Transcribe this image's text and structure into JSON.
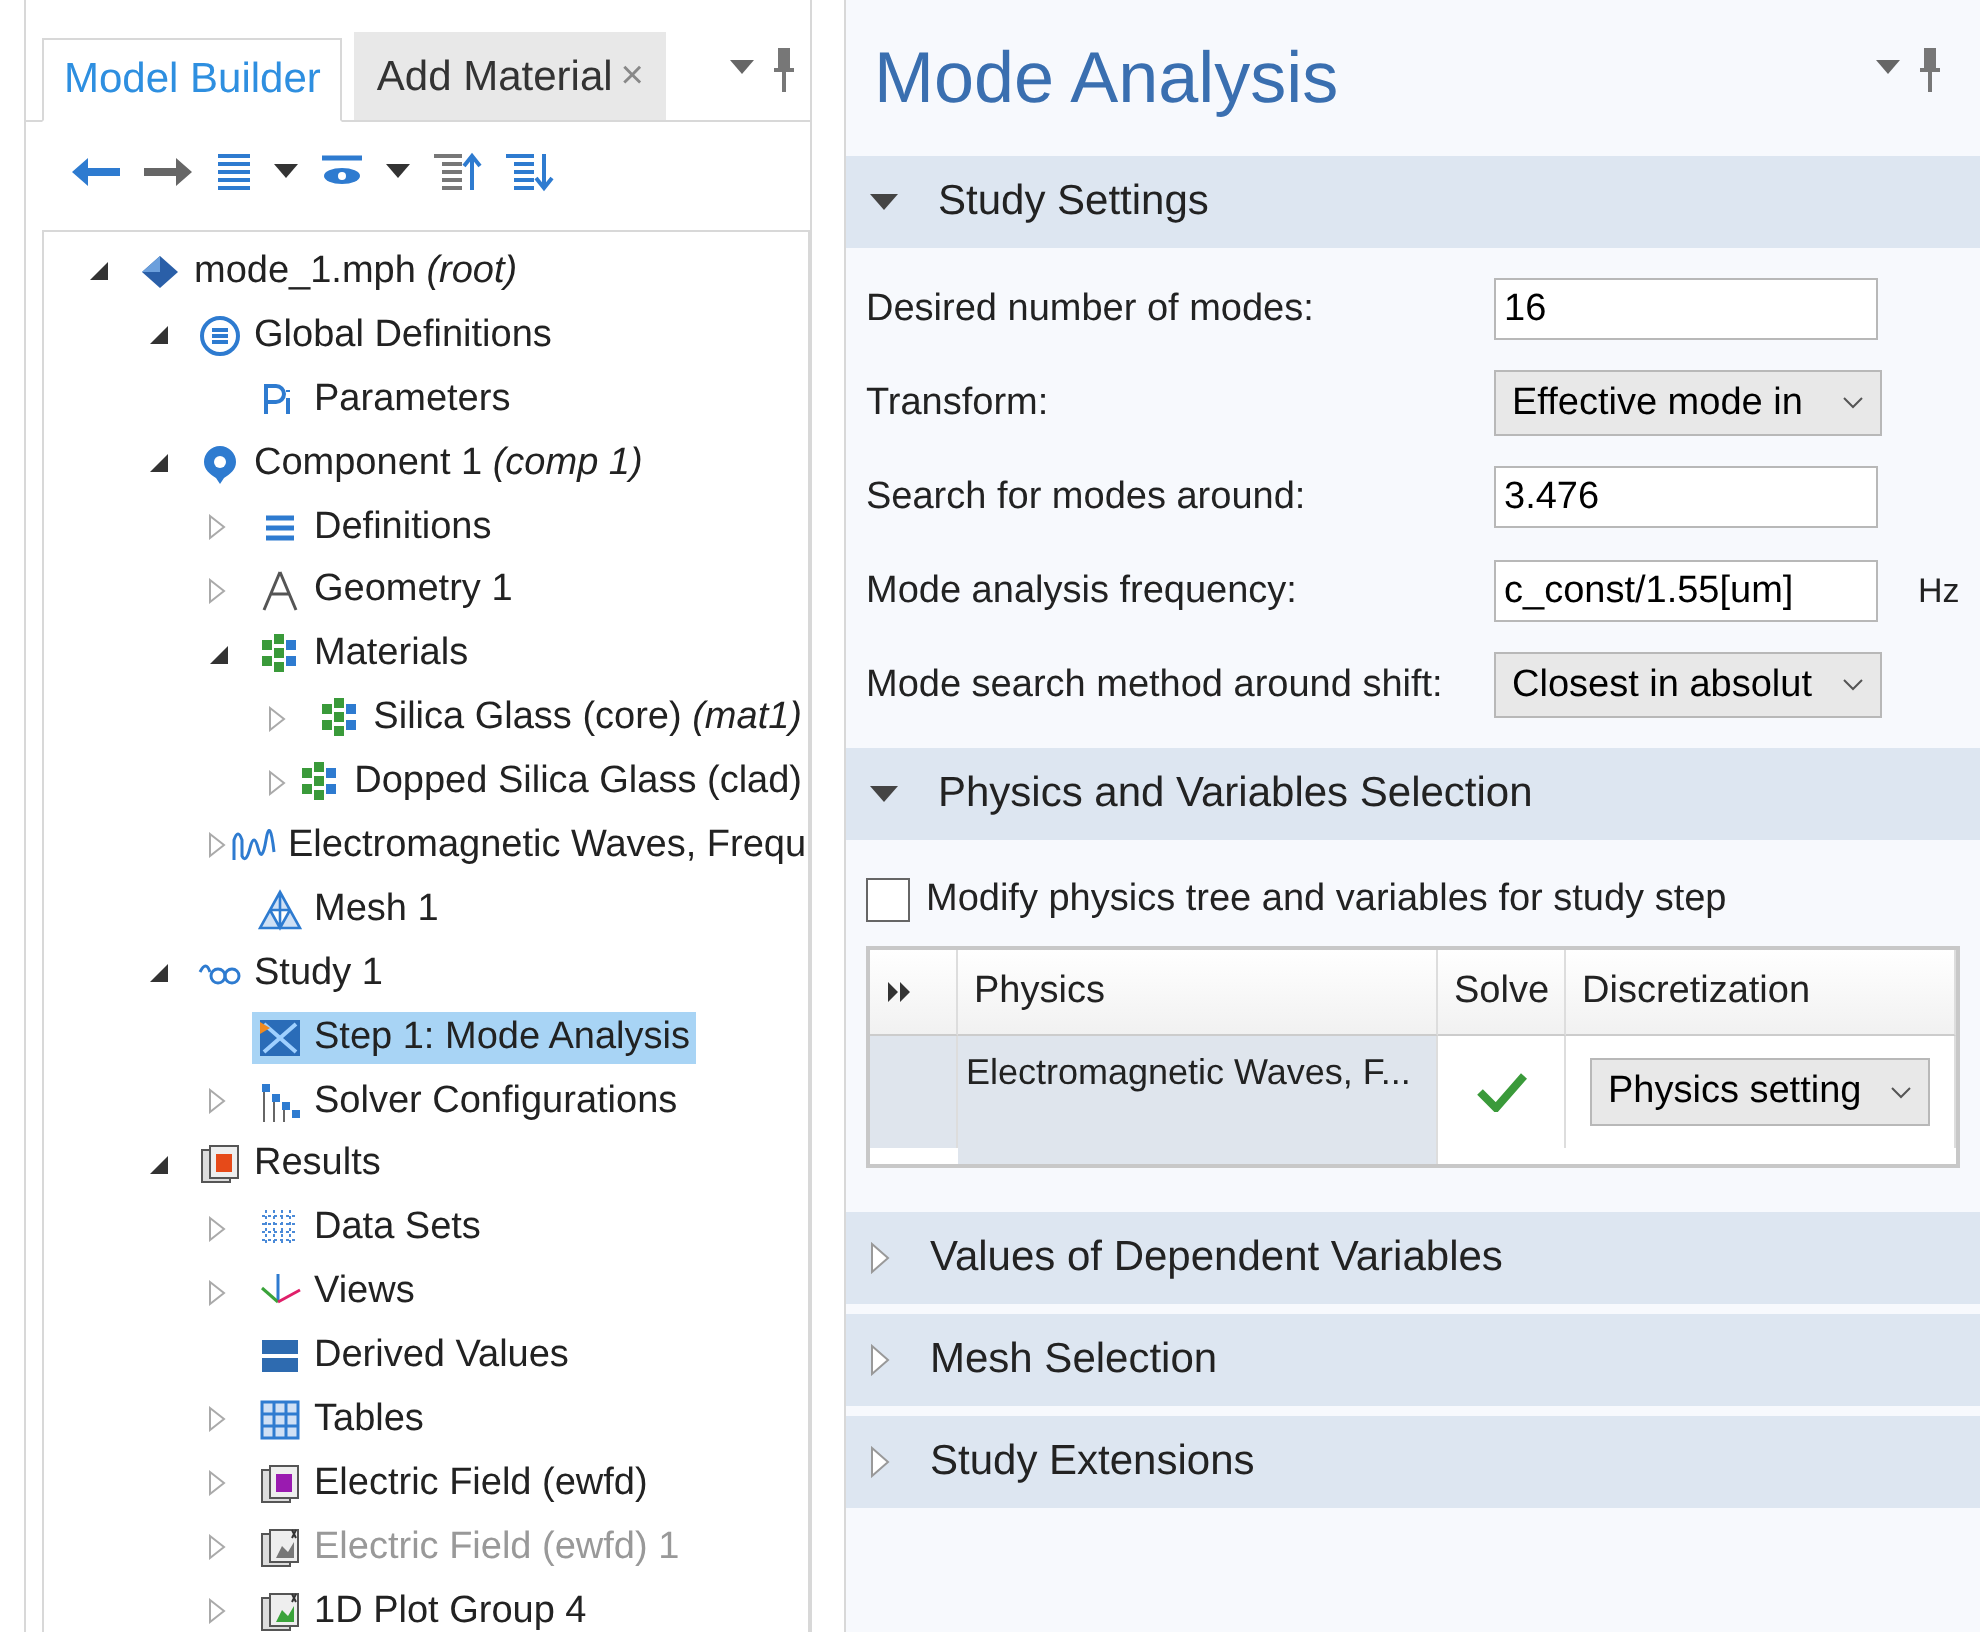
{
  "left_panel": {
    "tabs": [
      {
        "label": "Model Builder",
        "selected": true
      },
      {
        "label": "Add Material",
        "selected": false,
        "close": "×"
      }
    ],
    "tree": [
      {
        "label": "mode_1.mph *(root)*",
        "kind": "model",
        "expanded": true,
        "selected": false,
        "disabled": false,
        "children": [
          {
            "label": "Global Definitions",
            "kind": "global",
            "expanded": true,
            "selected": false,
            "disabled": false,
            "children": [
              {
                "label": "Parameters",
                "kind": "parameters",
                "selected": false,
                "disabled": false
              }
            ]
          },
          {
            "label": "Component 1 *(comp 1)*",
            "kind": "component",
            "expanded": true,
            "selected": false,
            "disabled": false,
            "children": [
              {
                "label": "Definitions",
                "kind": "definitions",
                "expanded": false,
                "selected": false,
                "disabled": false
              },
              {
                "label": "Geometry 1",
                "kind": "geometry",
                "expanded": false,
                "selected": false,
                "disabled": false
              },
              {
                "label": "Materials",
                "kind": "materials",
                "expanded": true,
                "selected": false,
                "disabled": false,
                "children": [
                  {
                    "label": "Silica Glass (core) *(mat1)*",
                    "kind": "materials",
                    "expanded": false,
                    "selected": false,
                    "disabled": false
                  },
                  {
                    "label": "Dopped Silica Glass (clad)",
                    "kind": "materials",
                    "expanded": false,
                    "selected": false,
                    "disabled": false
                  }
                ]
              },
              {
                "label": "Electromagnetic Waves, Frequ",
                "kind": "waves",
                "expanded": false,
                "selected": false,
                "disabled": false
              },
              {
                "label": "Mesh 1",
                "kind": "mesh",
                "selected": false,
                "disabled": false
              }
            ]
          },
          {
            "label": "Study 1",
            "kind": "study",
            "expanded": true,
            "selected": false,
            "disabled": false,
            "children": [
              {
                "label": "Step 1: Mode Analysis",
                "kind": "step",
                "selected": true,
                "disabled": false
              },
              {
                "label": "Solver Configurations",
                "kind": "solver",
                "expanded": false,
                "selected": false,
                "disabled": false
              }
            ]
          },
          {
            "label": "Results",
            "kind": "results",
            "expanded": true,
            "selected": false,
            "disabled": false,
            "children": [
              {
                "label": "Data Sets",
                "kind": "datasets",
                "expanded": false,
                "selected": false,
                "disabled": false
              },
              {
                "label": "Views",
                "kind": "views",
                "expanded": false,
                "selected": false,
                "disabled": false
              },
              {
                "label": "Derived Values",
                "kind": "derived",
                "selected": false,
                "disabled": false
              },
              {
                "label": "Tables",
                "kind": "tables",
                "expanded": false,
                "selected": false,
                "disabled": false
              },
              {
                "label": "Electric Field (ewfd)",
                "kind": "plot",
                "expanded": false,
                "selected": false,
                "disabled": false
              },
              {
                "label": "Electric Field (ewfd) 1",
                "kind": "plot2",
                "expanded": false,
                "selected": false,
                "disabled": true
              },
              {
                "label": "1D Plot Group 4",
                "kind": "plot3",
                "expanded": false,
                "selected": false,
                "disabled": false
              }
            ]
          }
        ]
      }
    ]
  },
  "settings": {
    "title": "Mode Analysis",
    "sections": [
      {
        "title": "Study Settings",
        "kind": "form",
        "expanded": true,
        "fields": [
          {
            "label": "Desired number of modes:",
            "kind": "text",
            "value": "16"
          },
          {
            "label": "Transform:",
            "kind": "select",
            "value": "Effective mode in"
          },
          {
            "label": "Search for modes around:",
            "kind": "text",
            "value": "3.476"
          },
          {
            "label": "Mode analysis frequency:",
            "kind": "text",
            "value": "c_const/1.55[um]",
            "unit": "Hz"
          },
          {
            "label": "Mode search method around shift:",
            "kind": "select",
            "value": "Closest in absolut"
          }
        ]
      },
      {
        "title": "Physics and Variables Selection",
        "kind": "physics",
        "expanded": true,
        "checkbox": {
          "label": "Modify physics tree and variables for study step",
          "checked": false
        },
        "table": {
          "columns": [
            "Physics",
            "Solve",
            "Discretization"
          ],
          "rows": [
            {
              "physics": "Electromagnetic Waves, F...",
              "solve": true,
              "discretization": "Physics setting"
            }
          ]
        }
      },
      {
        "title": "Values of Dependent Variables",
        "expanded": false
      },
      {
        "title": "Mesh Selection",
        "expanded": false
      },
      {
        "title": "Study Extensions",
        "expanded": false
      }
    ]
  }
}
